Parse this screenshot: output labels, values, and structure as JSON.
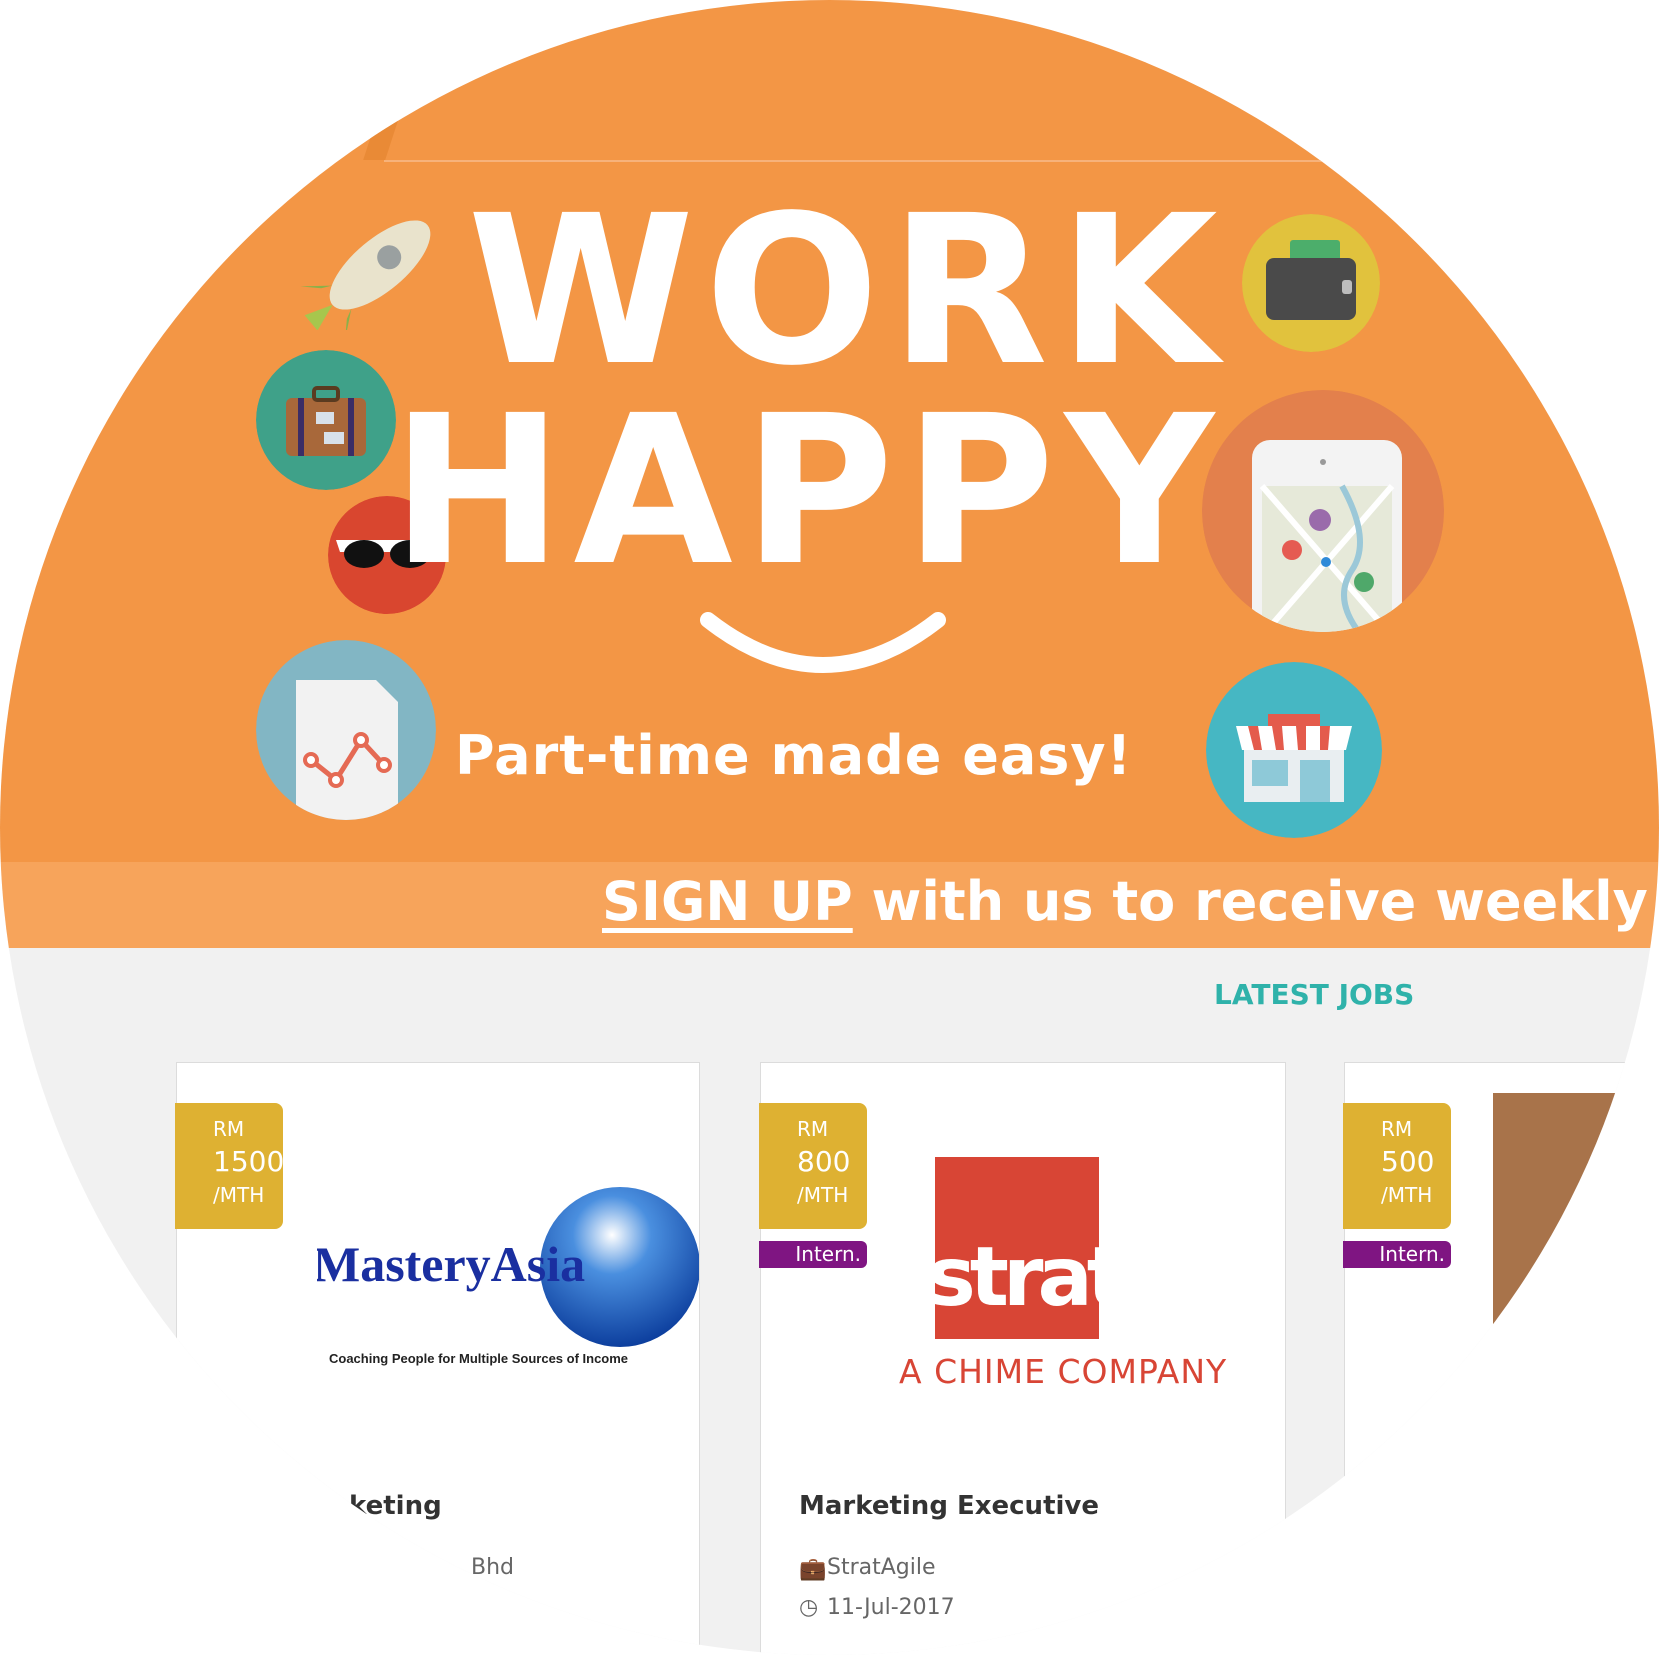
{
  "hero": {
    "title_line1": "WORK",
    "title_line2": "HAPPY",
    "tagline": "Part-time made easy!"
  },
  "banner": {
    "signup_link": "SIGN UP",
    "text": " with us to receive weekly j"
  },
  "section": {
    "heading": "LATEST JOBS"
  },
  "jobs": [
    {
      "salary_currency": "RM",
      "salary_amount": "1500",
      "salary_period": "/MTH",
      "logo_text": "MasteryAsia",
      "logo_tagline": "Coaching People for Multiple Sources of Income",
      "title": "keting",
      "company": "Bhd"
    },
    {
      "salary_currency": "RM",
      "salary_amount": "800",
      "salary_period": "/MTH",
      "type_badge": "Intern.",
      "logo_text": "stratagile",
      "logo_tagline": "A CHIME COMPANY",
      "title": "Marketing Executive",
      "company": "StratAgile",
      "date": "11-Jul-2017"
    },
    {
      "salary_currency": "RM",
      "salary_amount": "500",
      "salary_period": "/MTH",
      "type_badge": "Intern."
    }
  ],
  "colors": {
    "hero_orange": "#f39645",
    "banner_orange": "#f7a45b",
    "accent_teal": "#2fb2aa",
    "salary_gold": "#deb132",
    "intern_purple": "#7f1582"
  }
}
